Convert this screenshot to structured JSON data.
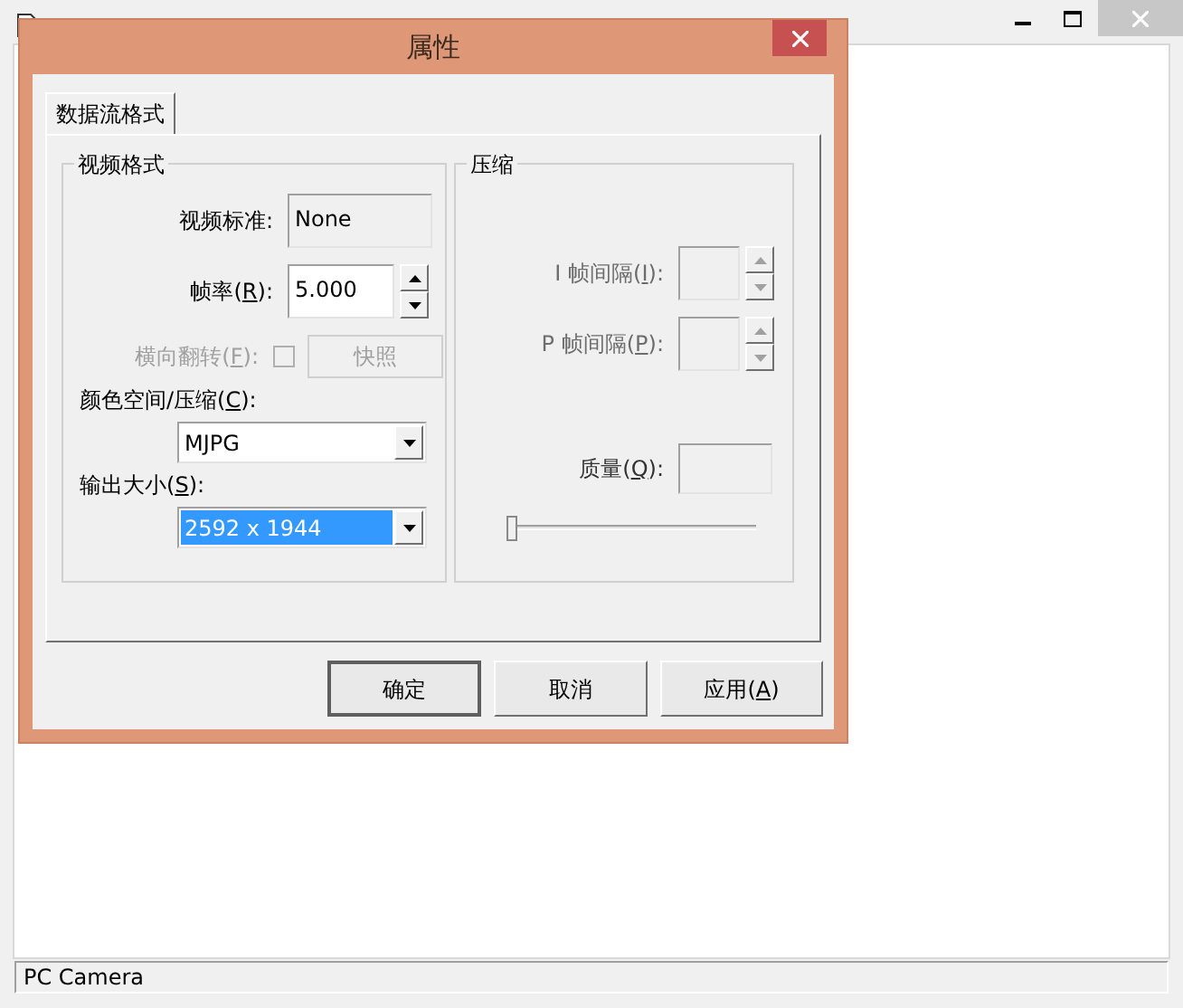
{
  "main_window": {
    "status_bar": "PC Camera"
  },
  "dialog": {
    "title": "属性",
    "tabs": [
      {
        "label": "数据流格式",
        "selected": true
      }
    ],
    "video_format": {
      "title": "视频格式",
      "rows": [
        {
          "kind": "readonly",
          "label": {
            "before": "视频标准:"
          },
          "value": "None"
        },
        {
          "kind": "spin",
          "label": {
            "before": "帧率(",
            "key": "R",
            "after": "):"
          },
          "value": "5.000",
          "disabled": false
        },
        {
          "kind": "checkbox",
          "label": {
            "before": "横向翻转(",
            "key": "F",
            "after": "):"
          },
          "checked": false,
          "disabled": true,
          "button": "快照"
        },
        {
          "kind": "combo",
          "label": {
            "before": "颜色空间/压缩(",
            "key": "C",
            "after": "):"
          },
          "value": "MJPG",
          "selected": false
        },
        {
          "kind": "combo",
          "label": {
            "before": "输出大小(",
            "key": "S",
            "after": "):"
          },
          "value": "2592 x 1944",
          "selected": true
        }
      ]
    },
    "compression": {
      "title": "压缩",
      "rows": [
        {
          "kind": "spin",
          "label": {
            "before": "I 帧间隔(",
            "key": "I",
            "after": "):"
          },
          "disabled": true
        },
        {
          "kind": "spin",
          "label": {
            "before": "P 帧间隔(",
            "key": "P",
            "after": "):"
          },
          "disabled": true
        },
        {
          "kind": "field",
          "label": {
            "before": "质量(",
            "key": "Q",
            "after": "):"
          },
          "disabled": true
        },
        {
          "kind": "slider",
          "level": 0
        }
      ]
    },
    "buttons": [
      {
        "label": {
          "before": "确定"
        },
        "default": true
      },
      {
        "label": {
          "before": "取消"
        },
        "default": false
      },
      {
        "label": {
          "before": "应用(",
          "key": "A",
          "after": ")"
        },
        "default": false
      }
    ]
  }
}
